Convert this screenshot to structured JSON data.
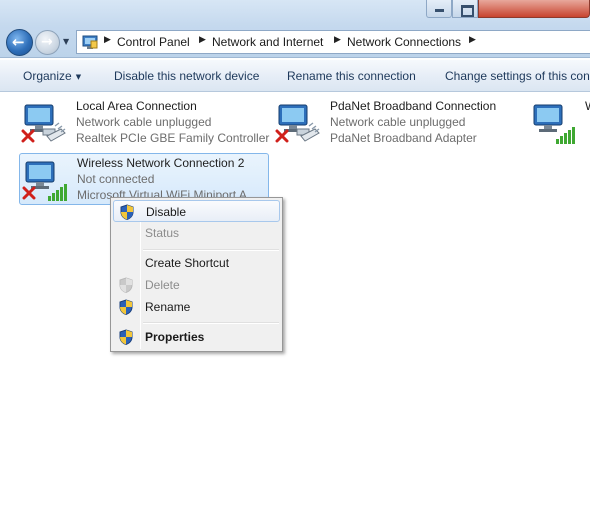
{
  "address": {
    "breadcrumbs": [
      "Control Panel",
      "Network and Internet",
      "Network Connections"
    ],
    "icon": "control-panel-icon"
  },
  "toolbar": {
    "organize": "Organize",
    "disable_device": "Disable this network device",
    "rename_connection": "Rename this connection",
    "change_settings": "Change settings of this con"
  },
  "connections": [
    {
      "name": "Local Area Connection",
      "status": "Network cable unplugged",
      "device": "Realtek PCIe GBE Family Controller",
      "icon": "wired-network-icon",
      "state": "disconnected"
    },
    {
      "name": "PdaNet Broadband Connection",
      "status": "Network cable unplugged",
      "device": "PdaNet Broadband Adapter",
      "icon": "wired-network-icon",
      "state": "disconnected"
    },
    {
      "name": "W",
      "status": "",
      "device": "",
      "icon": "wireless-network-icon",
      "state": "connected"
    },
    {
      "name": "Wireless Network Connection 2",
      "status": "Not connected",
      "device": "Microsoft Virtual WiFi Miniport A",
      "icon": "wireless-network-icon",
      "state": "disconnected",
      "selected": true
    }
  ],
  "context_menu": {
    "items": [
      {
        "label": "Disable",
        "icon": "shield-icon",
        "state": "hover"
      },
      {
        "label": "Status",
        "state": "disabled"
      },
      {
        "label": "Create Shortcut"
      },
      {
        "label": "Delete",
        "icon": "shield-icon",
        "state": "disabled"
      },
      {
        "label": "Rename",
        "icon": "shield-icon"
      },
      {
        "label": "Properties",
        "icon": "shield-icon",
        "state": "default-bold"
      }
    ]
  },
  "colors": {
    "selection_border": "#84b7ea",
    "link_text": "#1e395b",
    "status_gray": "#6d6d6d",
    "error_red": "#d0201b",
    "signal_green": "#3fa832"
  }
}
